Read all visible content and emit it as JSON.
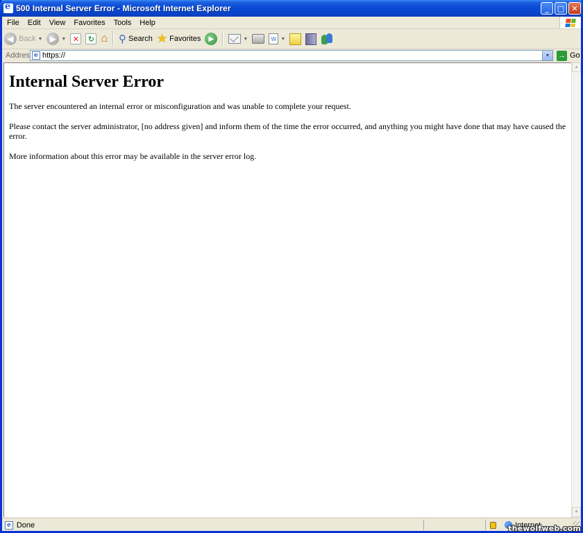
{
  "window": {
    "title": "500 Internal Server Error - Microsoft Internet Explorer",
    "icon": "ie-icon",
    "buttons": {
      "minimize": "_",
      "maximize": "□",
      "close": "✕"
    }
  },
  "menu": {
    "items": [
      "File",
      "Edit",
      "View",
      "Favorites",
      "Tools",
      "Help"
    ]
  },
  "toolbar": {
    "back_label": "Back",
    "search_label": "Search",
    "favorites_label": "Favorites"
  },
  "address": {
    "label": "Address",
    "url": "https://",
    "go_label": "Go"
  },
  "page": {
    "heading": "Internal Server Error",
    "paragraphs": [
      "The server encountered an internal error or misconfiguration and was unable to complete your request.",
      "Please contact the server administrator, [no address given] and inform them of the time the error occurred, and anything you might have done that may have caused the error.",
      "More information about this error may be available in the server error log."
    ]
  },
  "status": {
    "text": "Done",
    "zone": "Internet"
  },
  "watermark": "thewolfweb.com",
  "colors": {
    "titlebar": "#0846d1",
    "chrome": "#ece9d8",
    "border": "#0831d9"
  }
}
